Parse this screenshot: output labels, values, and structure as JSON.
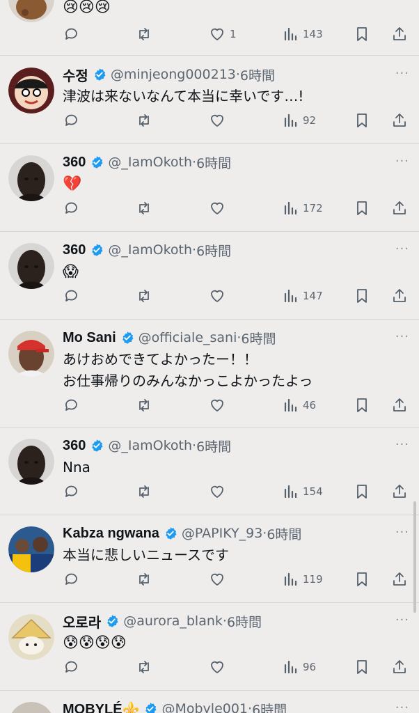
{
  "top_partial": {
    "text": "😢😢😢",
    "likes": "1",
    "views": "143"
  },
  "tweets": [
    {
      "name": "수정",
      "handle": "@minjeong000213",
      "time": "6時間",
      "text": "津波は来ないなんて本当に幸いです…!",
      "text2": "",
      "likes": "",
      "views": "92"
    },
    {
      "name": "360",
      "handle": "@_IamOkoth",
      "time": "6時間",
      "text": "💔",
      "text2": "",
      "likes": "",
      "views": "172"
    },
    {
      "name": "360",
      "handle": "@_IamOkoth",
      "time": "6時間",
      "text": "😱",
      "text2": "",
      "likes": "",
      "views": "147"
    },
    {
      "name": "Mo Sani",
      "handle": "@officiale_sani",
      "time": "6時間",
      "text": "あけおめできてよかったー！！",
      "text2": "お仕事帰りのみんなかっこよかったよっ",
      "likes": "",
      "views": "46"
    },
    {
      "name": "360",
      "handle": "@_IamOkoth",
      "time": "6時間",
      "text": "Nna",
      "text2": "",
      "likes": "",
      "views": "154"
    },
    {
      "name": "Kabza ngwana",
      "handle": "@PAPIKY_93",
      "time": "6時間",
      "text": "本当に悲しいニュースです",
      "text2": "",
      "likes": "",
      "views": "119"
    },
    {
      "name": "오로라",
      "handle": "@aurora_blank",
      "time": "6時間",
      "text": "😰😰😰😰",
      "text2": "",
      "likes": "",
      "views": "96"
    },
    {
      "name": "MOBYLÉ⚜️",
      "handle": "@Mobyle001",
      "time": "6時間",
      "text": "",
      "text2": "",
      "likes": "",
      "views": ""
    }
  ],
  "sep": "·",
  "more_label": "···",
  "colors": {
    "background": "#efedec",
    "verified": "#1d9bf0",
    "muted": "#5b6671",
    "divider": "#d8d6d5"
  },
  "icons": [
    "reply-icon",
    "retweet-icon",
    "like-icon",
    "views-icon",
    "bookmark-icon",
    "share-icon",
    "verified-badge-icon",
    "more-icon"
  ]
}
